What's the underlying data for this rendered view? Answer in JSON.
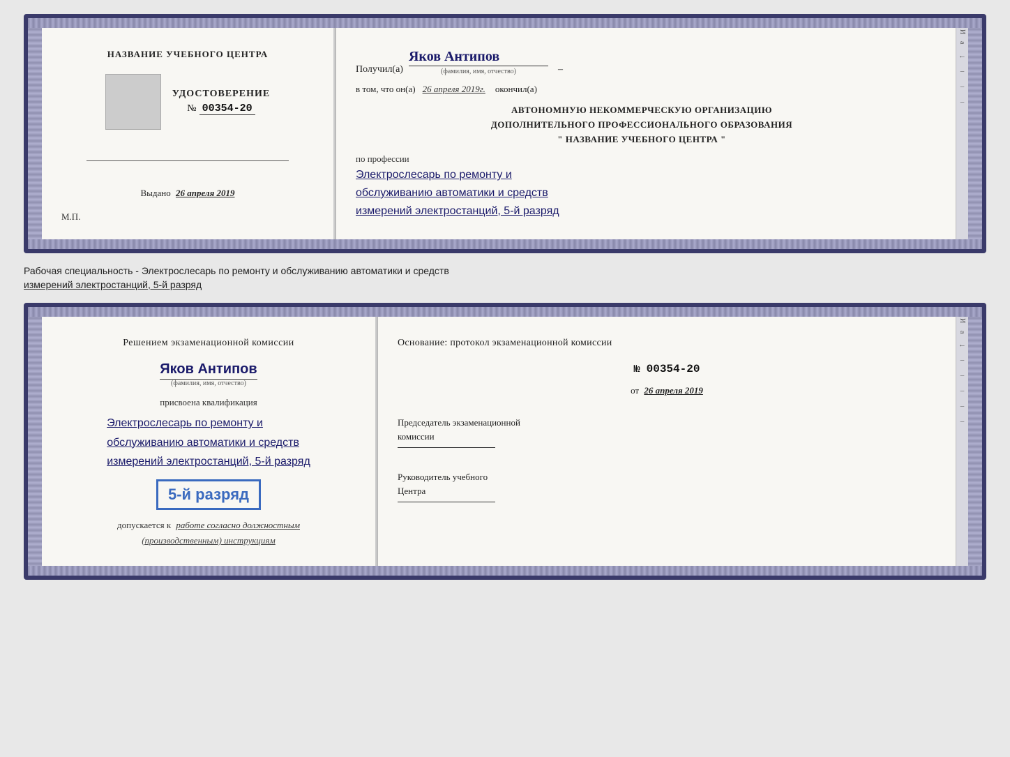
{
  "top_doc": {
    "left": {
      "center_title": "НАЗВАНИЕ УЧЕБНОГО ЦЕНТРА",
      "stamp_alt": "stamp",
      "udostoverenie_label": "УДОСТОВЕРЕНИЕ",
      "number_prefix": "№",
      "number": "00354-20",
      "vydano_label": "Выдано",
      "vydano_date": "26 апреля 2019",
      "mp_label": "М.П."
    },
    "right": {
      "poluchil_label": "Получил(а)",
      "poluchil_name": "Яков Антипов",
      "dash": "–",
      "fio_label": "(фамилия, имя, отчество)",
      "vtom_label": "в том, что он(а)",
      "okончил_date": "26 апреля 2019г.",
      "okончil_label": "окончил(а)",
      "org_line1": "АВТОНОМНУЮ НЕКОММЕРЧЕСКУЮ ОРГАНИЗАЦИЮ",
      "org_line2": "ДОПОЛНИТЕЛЬНОГО ПРОФЕССИОНАЛЬНОГО ОБРАЗОВАНИЯ",
      "org_line3": "\"    НАЗВАНИЕ УЧЕБНОГО ЦЕНТРА    \"",
      "po_professii_label": "по профессии",
      "profession_line1": "Электрослесарь по ремонту и",
      "profession_line2": "обслуживанию автоматики и средств",
      "profession_line3": "измерений электростанций, 5-й разряд"
    }
  },
  "separator": {
    "text_line1": "Рабочая специальность - Электрослесарь по ремонту и обслуживанию автоматики и средств",
    "text_line2": "измерений электростанций, 5-й разряд"
  },
  "bottom_doc": {
    "left": {
      "resheniem_label": "Решением экзаменационной комиссии",
      "name": "Яков Антипов",
      "fio_label": "(фамилия, имя, отчество)",
      "prisvoena_label": "присвоена квалификация",
      "qual_line1": "Электрослесарь по ремонту и",
      "qual_line2": "обслуживанию автоматики и средств",
      "qual_line3": "измерений электростанций, 5-й разряд",
      "razryad_badge": "5-й разряд",
      "dopuskaetsya_prefix": "допускается к",
      "dopuskaetsya_text": "работе согласно должностным",
      "dopuskaetsya_line2": "(производственным) инструкциям"
    },
    "right": {
      "osnovanie_label": "Основание: протокол экзаменационной комиссии",
      "number_prefix": "№",
      "protocol_number": "00354-20",
      "ot_label": "от",
      "ot_date": "26 апреля 2019",
      "predsedatel_label": "Председатель экзаменационной",
      "komissia_label": "комиссии",
      "rukovoditel_label": "Руководитель учебного",
      "centra_label": "Центра"
    }
  },
  "side_strip": {
    "marks": [
      "И",
      "а",
      "←",
      "–",
      "–",
      "–",
      "–",
      "–"
    ]
  }
}
